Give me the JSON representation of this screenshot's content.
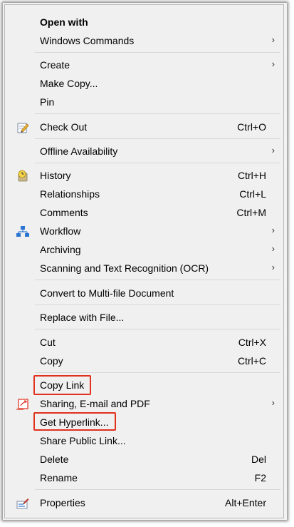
{
  "menu": {
    "open_with": "Open with",
    "windows_commands": "Windows Commands",
    "create": "Create",
    "make_copy": "Make Copy...",
    "pin": "Pin",
    "check_out": "Check Out",
    "check_out_shortcut": "Ctrl+O",
    "offline_availability": "Offline Availability",
    "history": "History",
    "history_shortcut": "Ctrl+H",
    "relationships": "Relationships",
    "relationships_shortcut": "Ctrl+L",
    "comments": "Comments",
    "comments_shortcut": "Ctrl+M",
    "workflow": "Workflow",
    "archiving": "Archiving",
    "scanning_ocr": "Scanning and Text Recognition (OCR)",
    "convert_multifile": "Convert to Multi-file Document",
    "replace_with_file": "Replace with File...",
    "cut": "Cut",
    "cut_shortcut": "Ctrl+X",
    "copy": "Copy",
    "copy_shortcut": "Ctrl+C",
    "copy_link": "Copy Link",
    "sharing_email_pdf": "Sharing, E-mail and PDF",
    "get_hyperlink": "Get Hyperlink...",
    "share_public_link": "Share Public Link...",
    "delete": "Delete",
    "delete_shortcut": "Del",
    "rename": "Rename",
    "rename_shortcut": "F2",
    "properties": "Properties",
    "properties_shortcut": "Alt+Enter",
    "submenu_arrow": "›"
  },
  "colors": {
    "highlight_border": "#e0301e",
    "menu_background": "#f0f0f0",
    "separator": "#d7d7d7"
  },
  "icons": {
    "check_out": "pencil-note-icon",
    "history": "clock-history-icon",
    "workflow": "workflow-tree-icon",
    "sharing": "share-pdf-icon",
    "properties": "properties-icon"
  }
}
